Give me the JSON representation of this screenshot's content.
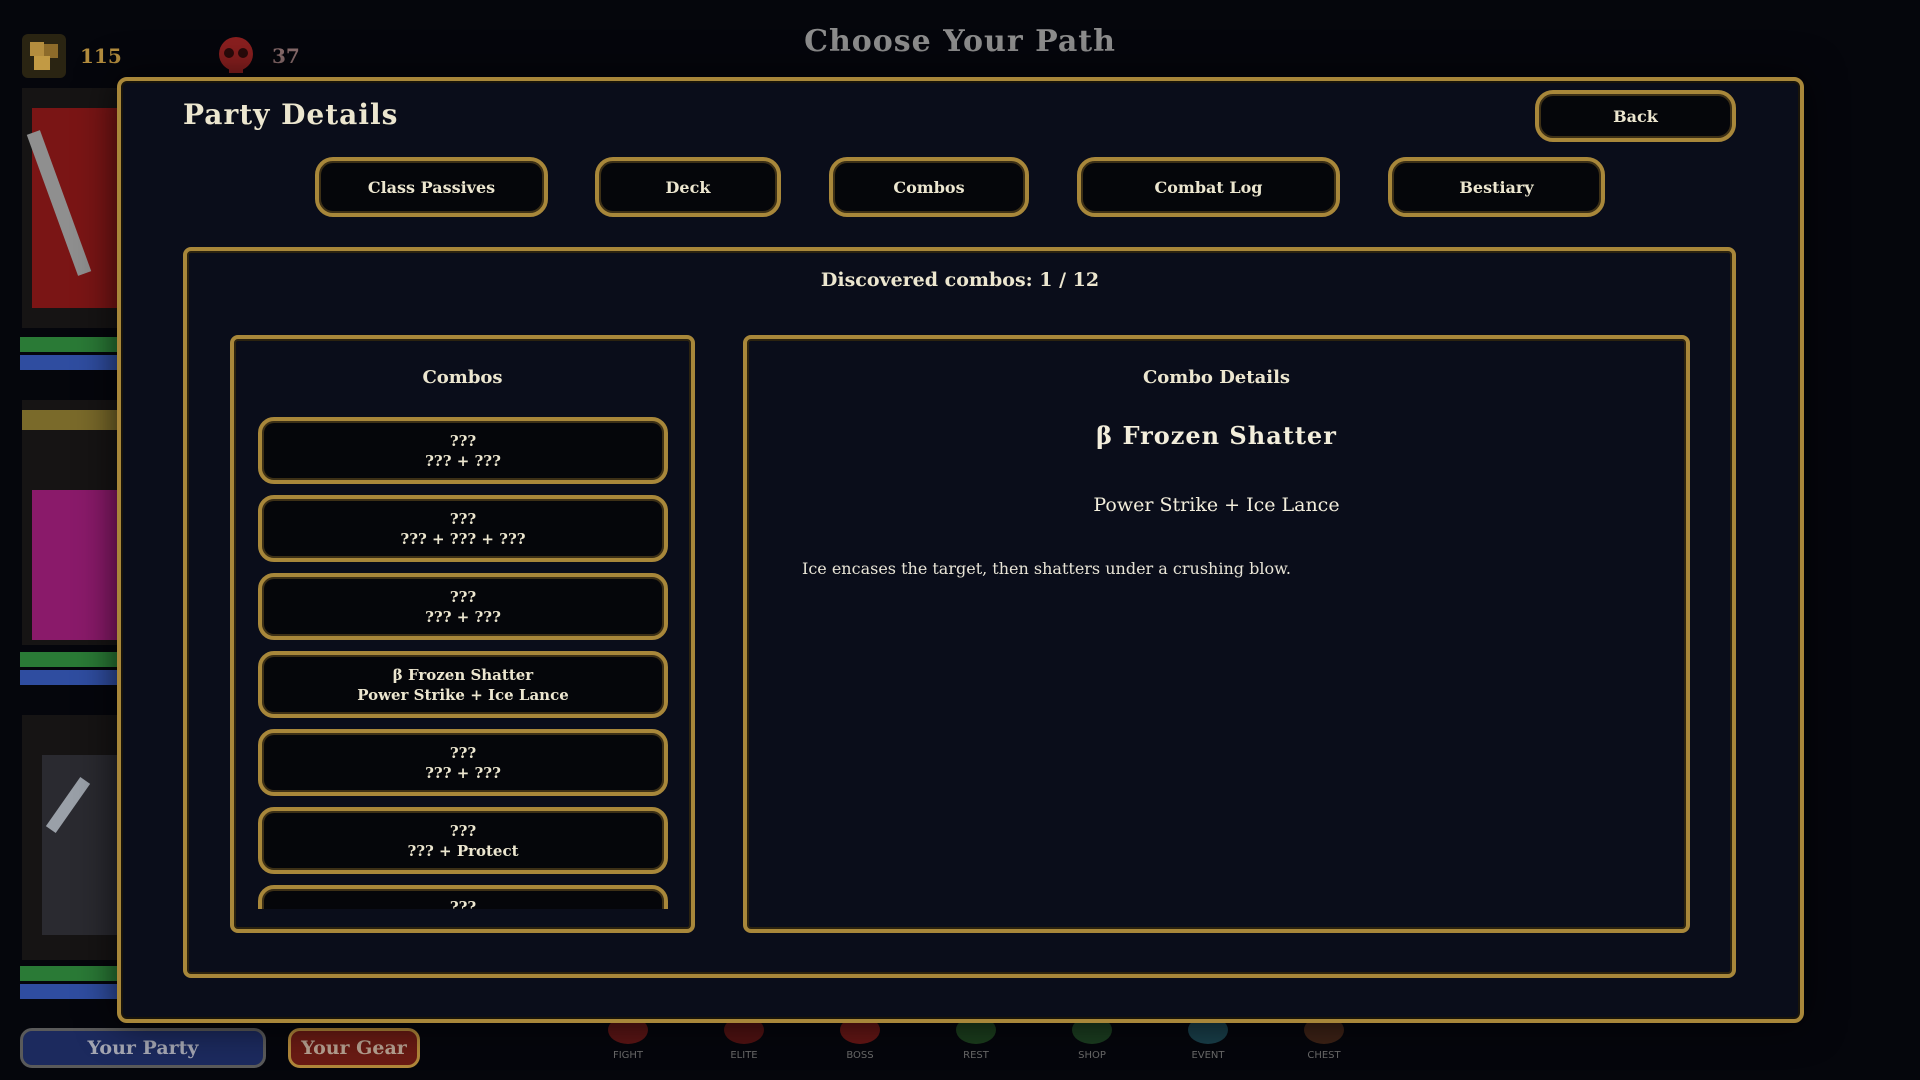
{
  "background": {
    "title": "Choose Your Path",
    "gold": "115",
    "skulls": "37",
    "party_button": "Your Party",
    "gear_button": "Your Gear",
    "map_legend": [
      {
        "label": "FIGHT",
        "color": "#a3231e"
      },
      {
        "label": "ELITE",
        "color": "#8e1d18"
      },
      {
        "label": "BOSS",
        "color": "#b3241d"
      },
      {
        "label": "REST",
        "color": "#2d6b2c"
      },
      {
        "label": "SHOP",
        "color": "#2e6b32"
      },
      {
        "label": "EVENT",
        "color": "#2a6f7e"
      },
      {
        "label": "CHEST",
        "color": "#6b3a1f"
      }
    ]
  },
  "modal": {
    "title": "Party Details",
    "back_label": "Back",
    "tabs": [
      "Class Passives",
      "Deck",
      "Combos",
      "Combat Log",
      "Bestiary"
    ],
    "discovered_label": "Discovered combos: 1 / 12"
  },
  "combos_panel": {
    "heading": "Combos",
    "items": [
      {
        "name": "???",
        "recipe": "??? + ???"
      },
      {
        "name": "???",
        "recipe": "??? + ??? + ???"
      },
      {
        "name": "???",
        "recipe": "??? + ???"
      },
      {
        "name": "β Frozen Shatter",
        "recipe": "Power Strike + Ice Lance"
      },
      {
        "name": "???",
        "recipe": "??? + ???"
      },
      {
        "name": "???",
        "recipe": "??? + Protect"
      },
      {
        "name": "???",
        "recipe": ""
      }
    ]
  },
  "details_panel": {
    "heading": "Combo Details",
    "name": "β Frozen Shatter",
    "recipe": "Power Strike + Ice Lance",
    "description": "Ice encases the target, then shatters under a crushing blow."
  },
  "colors": {
    "gold_border": "#a8873a",
    "panel_bg": "#0a0d1a",
    "button_bg": "#05060a",
    "text": "#ece6cf"
  }
}
